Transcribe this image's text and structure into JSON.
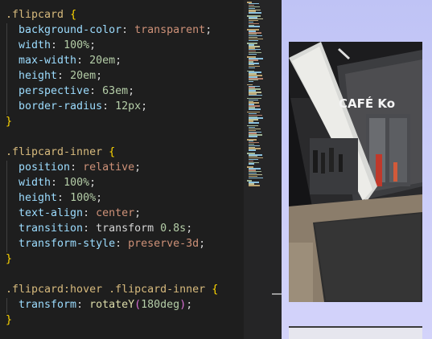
{
  "editor": {
    "lines": [
      [
        {
          "t": ".flipcard",
          "c": "sel"
        },
        {
          "t": " ",
          "c": "punc"
        },
        {
          "t": "{",
          "c": "brace"
        }
      ],
      [
        {
          "t": "  background-color",
          "c": "prop"
        },
        {
          "t": ": ",
          "c": "punc"
        },
        {
          "t": "transparent",
          "c": "val"
        },
        {
          "t": ";",
          "c": "punc"
        }
      ],
      [
        {
          "t": "  width",
          "c": "prop"
        },
        {
          "t": ": ",
          "c": "punc"
        },
        {
          "t": "100%",
          "c": "num"
        },
        {
          "t": ";",
          "c": "punc"
        }
      ],
      [
        {
          "t": "  max-width",
          "c": "prop"
        },
        {
          "t": ": ",
          "c": "punc"
        },
        {
          "t": "20em",
          "c": "num"
        },
        {
          "t": ";",
          "c": "punc"
        }
      ],
      [
        {
          "t": "  height",
          "c": "prop"
        },
        {
          "t": ": ",
          "c": "punc"
        },
        {
          "t": "20em",
          "c": "num"
        },
        {
          "t": ";",
          "c": "punc"
        }
      ],
      [
        {
          "t": "  perspective",
          "c": "prop"
        },
        {
          "t": ": ",
          "c": "punc"
        },
        {
          "t": "63em",
          "c": "num"
        },
        {
          "t": ";",
          "c": "punc"
        }
      ],
      [
        {
          "t": "  border-radius",
          "c": "prop"
        },
        {
          "t": ": ",
          "c": "punc"
        },
        {
          "t": "12px",
          "c": "num"
        },
        {
          "t": ";",
          "c": "punc"
        }
      ],
      [
        {
          "t": "}",
          "c": "brace"
        }
      ],
      [],
      [
        {
          "t": ".flipcard-inner",
          "c": "sel"
        },
        {
          "t": " ",
          "c": "punc"
        },
        {
          "t": "{",
          "c": "brace"
        }
      ],
      [
        {
          "t": "  position",
          "c": "prop"
        },
        {
          "t": ": ",
          "c": "punc"
        },
        {
          "t": "relative",
          "c": "val"
        },
        {
          "t": ";",
          "c": "punc"
        }
      ],
      [
        {
          "t": "  width",
          "c": "prop"
        },
        {
          "t": ": ",
          "c": "punc"
        },
        {
          "t": "100%",
          "c": "num"
        },
        {
          "t": ";",
          "c": "punc"
        }
      ],
      [
        {
          "t": "  height",
          "c": "prop"
        },
        {
          "t": ": ",
          "c": "punc"
        },
        {
          "t": "100%",
          "c": "num"
        },
        {
          "t": ";",
          "c": "punc"
        }
      ],
      [
        {
          "t": "  text-align",
          "c": "prop"
        },
        {
          "t": ": ",
          "c": "punc"
        },
        {
          "t": "center",
          "c": "val"
        },
        {
          "t": ";",
          "c": "punc"
        }
      ],
      [
        {
          "t": "  transition",
          "c": "prop"
        },
        {
          "t": ": ",
          "c": "punc"
        },
        {
          "t": "transform ",
          "c": "punc"
        },
        {
          "t": "0.8s",
          "c": "num"
        },
        {
          "t": ";",
          "c": "punc"
        }
      ],
      [
        {
          "t": "  transform-style",
          "c": "prop"
        },
        {
          "t": ": ",
          "c": "punc"
        },
        {
          "t": "preserve-3d",
          "c": "val"
        },
        {
          "t": ";",
          "c": "punc"
        }
      ],
      [
        {
          "t": "}",
          "c": "brace"
        }
      ],
      [],
      [
        {
          "t": ".flipcard:hover .flipcard-inner",
          "c": "sel"
        },
        {
          "t": " ",
          "c": "punc"
        },
        {
          "t": "{",
          "c": "brace"
        }
      ],
      [
        {
          "t": "  transform",
          "c": "prop"
        },
        {
          "t": ": ",
          "c": "punc"
        },
        {
          "t": "rotateY",
          "c": "fn"
        },
        {
          "t": "(",
          "c": "paren"
        },
        {
          "t": "180deg",
          "c": "num"
        },
        {
          "t": ")",
          "c": "paren"
        },
        {
          "t": ";",
          "c": "punc"
        }
      ],
      [
        {
          "t": "}",
          "c": "brace"
        }
      ]
    ]
  },
  "preview": {
    "cafe_sign": "CAFÉ Ko"
  },
  "colors": {
    "editor_bg": "#1e1e1e",
    "selector": "#d7ba7d",
    "property": "#9cdcfe",
    "string_value": "#ce9178",
    "number": "#b5cea8",
    "brace": "#ffd700",
    "preview_bg": "#c4c6f6"
  }
}
